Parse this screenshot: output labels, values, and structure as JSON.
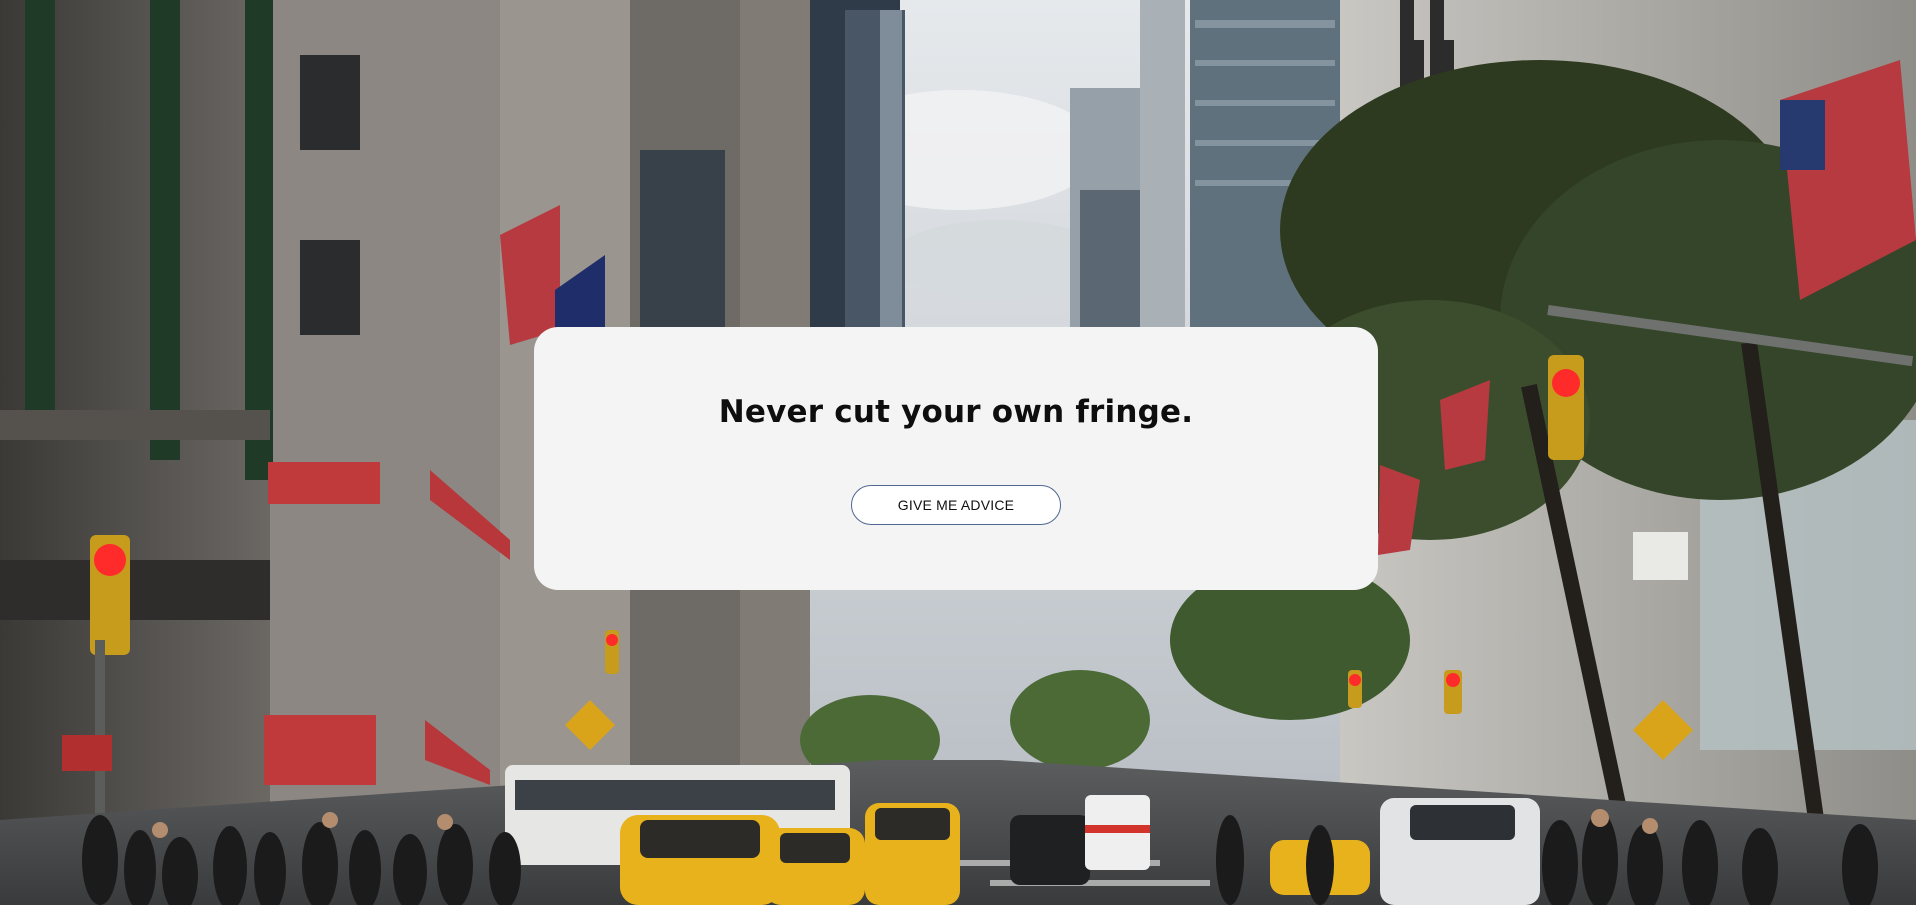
{
  "page": {
    "background": "new-york-city-street-photo"
  },
  "card": {
    "advice_text": "Never cut your own fringe.",
    "button_label": "GIVE ME ADVICE"
  },
  "colors": {
    "card_background": "#f4f4f4",
    "button_border": "#4f6791",
    "text": "#0e0e0e"
  }
}
